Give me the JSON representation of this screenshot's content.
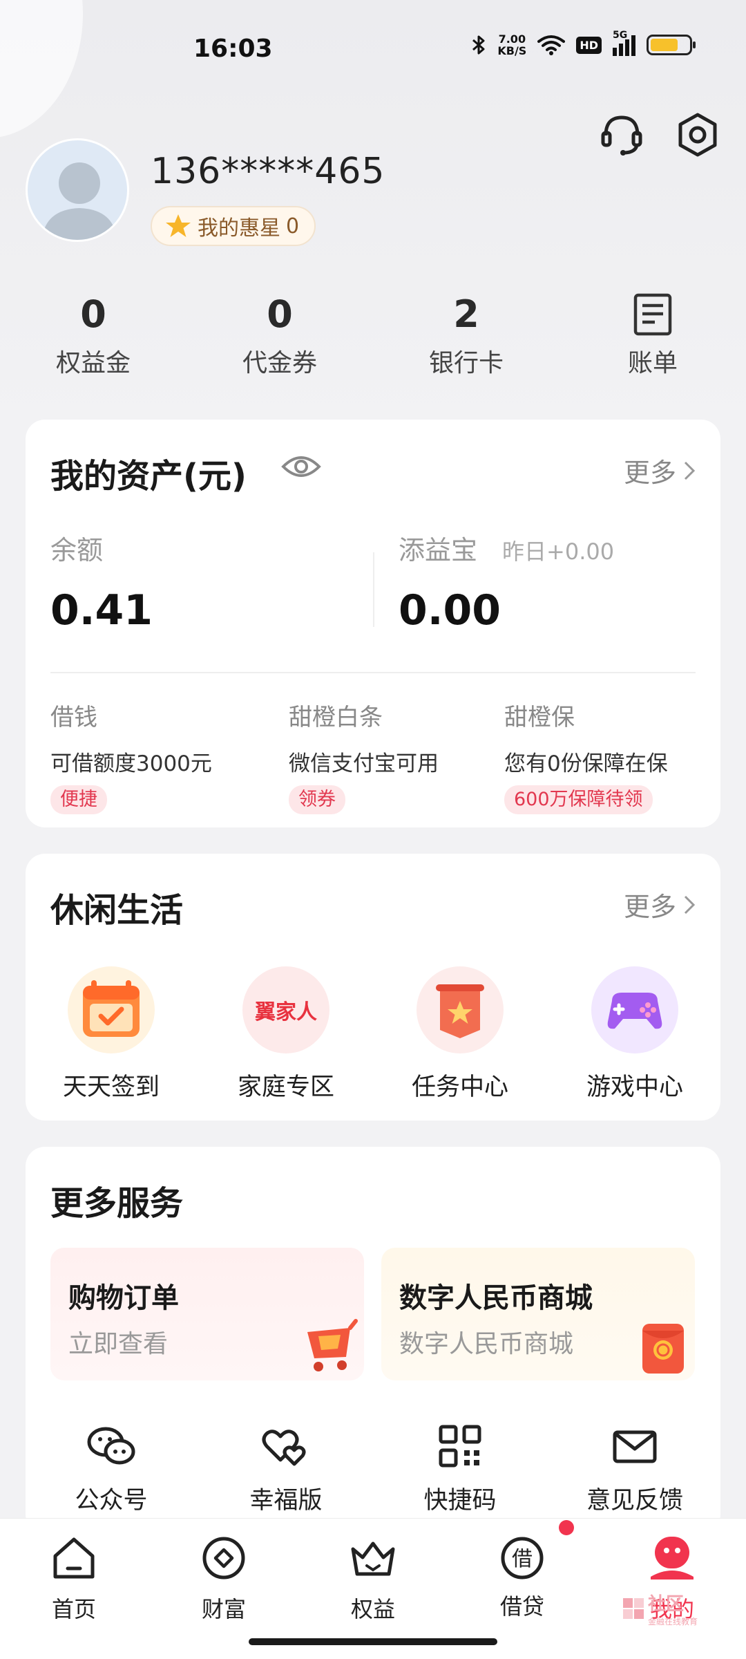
{
  "status": {
    "time": "16:03",
    "net_speed_value": "7.00",
    "net_speed_unit": "KB/S",
    "hd": "HD",
    "signal": "5G"
  },
  "profile": {
    "phone": "136*****465",
    "star_label": "我的惠星",
    "star_count": "0"
  },
  "stats": [
    {
      "value": "0",
      "label": "权益金"
    },
    {
      "value": "0",
      "label": "代金券"
    },
    {
      "value": "2",
      "label": "银行卡"
    },
    {
      "label": "账单"
    }
  ],
  "assets": {
    "title": "我的资产(元)",
    "more": "更多",
    "balance_label": "余额",
    "balance_value": "0.41",
    "tianyibao_label": "添益宝",
    "yesterday": "昨日+0.00",
    "tianyibao_value": "0.00",
    "items": [
      {
        "title": "借钱",
        "desc": "可借额度3000元",
        "tag": "便捷"
      },
      {
        "title": "甜橙白条",
        "desc": "微信支付宝可用",
        "tag": "领券"
      },
      {
        "title": "甜橙保",
        "desc": "您有0份保障在保",
        "tag": "600万保障待领"
      }
    ]
  },
  "leisure": {
    "title": "休闲生活",
    "more": "更多",
    "family_logo_text": "翼家人",
    "items": [
      {
        "label": "天天签到",
        "icon": "calendar-check-icon"
      },
      {
        "label": "家庭专区",
        "icon": "family-logo-icon"
      },
      {
        "label": "任务中心",
        "icon": "task-banner-icon"
      },
      {
        "label": "游戏中心",
        "icon": "gamepad-icon"
      }
    ]
  },
  "services": {
    "title": "更多服务",
    "tiles": [
      {
        "title": "购物订单",
        "sub": "立即查看",
        "icon": "shopping-cart-icon"
      },
      {
        "title": "数字人民币商城",
        "sub": "数字人民币商城",
        "icon": "red-envelope-icon"
      }
    ],
    "quick": [
      {
        "label": "公众号",
        "icon": "wechat-icon"
      },
      {
        "label": "幸福版",
        "icon": "hearts-icon"
      },
      {
        "label": "快捷码",
        "icon": "qr-code-icon"
      },
      {
        "label": "意见反馈",
        "icon": "mail-icon"
      }
    ]
  },
  "nav": {
    "items": [
      {
        "label": "首页",
        "icon": "home-icon"
      },
      {
        "label": "财富",
        "icon": "wealth-icon"
      },
      {
        "label": "权益",
        "icon": "crown-icon"
      },
      {
        "label": "借贷",
        "icon": "loan-icon",
        "glyph": "借"
      },
      {
        "label": "我的",
        "icon": "profile-icon",
        "active": true
      }
    ]
  },
  "watermark": {
    "text": "社区",
    "sub": "金融在线教育"
  },
  "colors": {
    "accent": "#f1344e",
    "tag_bg": "#fde6e8",
    "star": "#f7b52a"
  }
}
